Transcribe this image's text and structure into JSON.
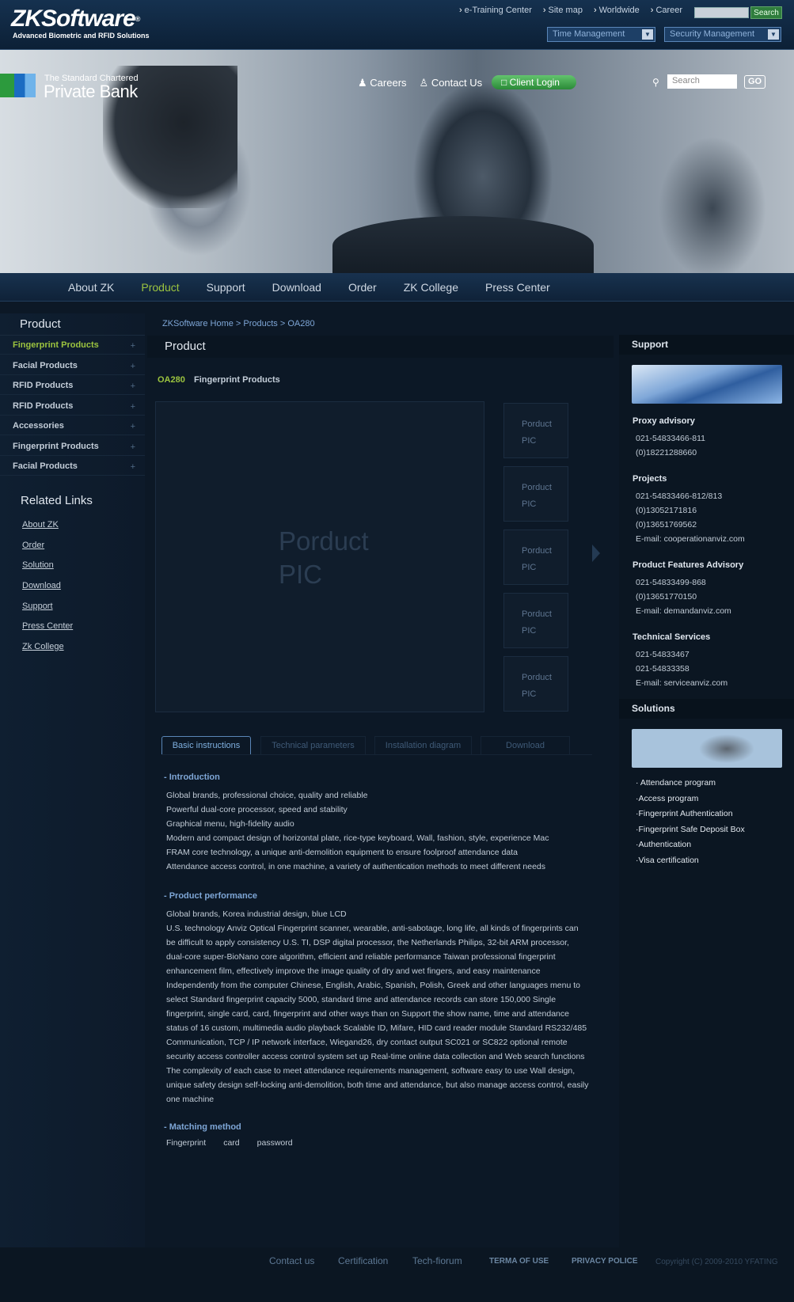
{
  "header": {
    "logo": "ZKSoftware",
    "logo_reg": "®",
    "tagline": "Advanced Biometric and  RFID Solutions",
    "top_links": [
      "e-Training Center",
      "Site map",
      "Worldwide",
      "Career"
    ],
    "search_button": "Search",
    "dropdown_time": "Time Management",
    "dropdown_security": "Security Management"
  },
  "hero": {
    "bank_line1": "The Standard Chartered",
    "bank_line2": "Private Bank",
    "nav": [
      "Careers",
      "Contact Us"
    ],
    "client_login": "Client Login",
    "search_placeholder": "Search",
    "go": "GO"
  },
  "main_nav": [
    "About ZK",
    "Product",
    "Support",
    "Download",
    "Order",
    "ZK College",
    "Press Center"
  ],
  "left": {
    "title": "Product",
    "categories": [
      "Fingerprint Products",
      "Facial Products",
      "RFID Products",
      "RFID Products",
      "Accessories",
      "Fingerprint Products",
      "Facial Products"
    ],
    "related_title": "Related Links",
    "related": [
      "About ZK",
      "Order",
      "Solution",
      "Download",
      "Support",
      "Press Center",
      "Zk College"
    ]
  },
  "center": {
    "breadcrumb": "ZKSoftware Home > Products > OA280",
    "title": "Product",
    "product_code": "OA280",
    "product_name": "Fingerprint Products",
    "big_pic_l1": "Porduct",
    "big_pic_l2": "PIC",
    "thumb_l1": "Porduct",
    "thumb_l2": "PIC",
    "tabs": [
      "Basic instructions",
      "Technical parameters",
      "Installation diagram",
      "Download"
    ],
    "intro_title": "- Introduction",
    "intro_lines": [
      "Global brands, professional choice, quality and reliable",
      "Powerful dual-core processor, speed and stability",
      "Graphical menu, high-fidelity audio",
      "Modern and compact design of horizontal plate, rice-type keyboard, Wall, fashion, style, experience Mac",
      "FRAM core technology, a unique anti-demolition equipment to ensure foolproof attendance data",
      "Attendance access control, in one machine, a variety of authentication methods to meet different needs"
    ],
    "perf_title": "- Product performance",
    "perf_line1": "Global brands, Korea industrial design, blue LCD",
    "perf_text": "U.S. technology Anviz Optical Fingerprint scanner, wearable, anti-sabotage, long life, all kinds of fingerprints can be difficult to apply consistency U.S. TI, DSP digital processor, the Netherlands Philips, 32-bit ARM processor, dual-core super-BioNano core algorithm, efficient and reliable performance Taiwan professional fingerprint enhancement film, effectively improve the image quality of dry and wet fingers, and easy maintenance Independently from the computer Chinese, English, Arabic, Spanish, Polish, Greek and other languages menu to select Standard fingerprint capacity 5000, standard time and attendance records can store 150,000 Single fingerprint, single card, card, fingerprint and other ways than on Support the show name, time and attendance status of 16 custom, multimedia audio playback Scalable ID, Mifare, HID card reader module Standard RS232/485 Communication, TCP / IP network interface, Wiegand26, dry contact output SC021 or SC822 optional remote security access controller access control system set up Real-time online data collection and Web search functions The complexity of each case to meet attendance requirements management, software easy to use Wall design, unique safety design self-locking anti-demolition, both time and attendance, but also manage access control, easily one machine",
    "match_title": "- Matching method",
    "match_items": [
      "Fingerprint",
      "card",
      "password"
    ]
  },
  "right": {
    "support_title": "Support",
    "proxy_title": "Proxy advisory",
    "proxy_lines": [
      "021-54833466-811",
      "(0)18221288660"
    ],
    "projects_title": "Projects",
    "projects_lines": [
      "021-54833466-812/813",
      "(0)13052171816",
      "(0)13651769562",
      "E-mail: cooperationanviz.com"
    ],
    "features_title": "Product Features Advisory",
    "features_lines": [
      "021-54833499-868",
      "(0)13651770150",
      "E-mail: demandanviz.com"
    ],
    "tech_title": "Technical Services",
    "tech_lines": [
      "021-54833467",
      "021-54833358",
      "E-mail: serviceanviz.com"
    ],
    "solutions_title": "Solutions",
    "solutions": [
      "· Attendance program",
      "·Access program",
      "·Fingerprint Authentication",
      "·Fingerprint Safe Deposit Box",
      "·Authentication",
      "·Visa certification"
    ]
  },
  "footer": {
    "links": [
      "Contact us",
      "Certification",
      "Tech-fiorum"
    ],
    "small_links": [
      "TERMA OF USE",
      "PRIVACY POLICE"
    ],
    "copyright": "Copyright (C) 2009-2010 YFATING"
  }
}
